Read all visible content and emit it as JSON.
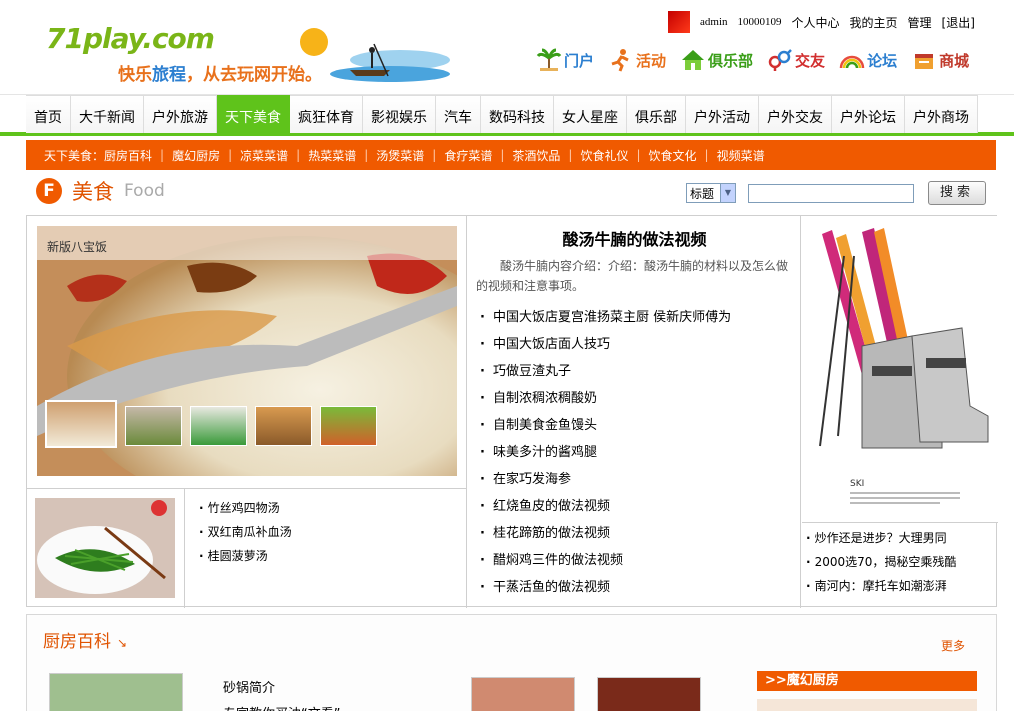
{
  "header": {
    "logo": "71play.com",
    "slogan_a": "快乐",
    "slogan_b": "旅程",
    "slogan_c": "，从去玩网开始。",
    "user": {
      "name": "admin",
      "uid": "10000109",
      "links": [
        "个人中心",
        "我的主页",
        "管理",
        "[退出]"
      ]
    },
    "main_nav": [
      {
        "label": "门户",
        "icon": "palm-tree-icon",
        "color": "#2c7fd0"
      },
      {
        "label": "活动",
        "icon": "runner-icon",
        "color": "#e8711c"
      },
      {
        "label": "俱乐部",
        "icon": "house-icon",
        "color": "#3a9e18"
      },
      {
        "label": "交友",
        "icon": "gender-icon",
        "color": "#d22f2f"
      },
      {
        "label": "论坛",
        "icon": "rainbow-icon",
        "color": "#2c7fd0"
      },
      {
        "label": "商城",
        "icon": "shop-icon",
        "color": "#c0392b"
      }
    ]
  },
  "category_nav": [
    "首页",
    "大千新闻",
    "户外旅游",
    "天下美食",
    "疯狂体育",
    "影视娱乐",
    "汽车",
    "数码科技",
    "女人星座",
    "俱乐部",
    "户外活动",
    "户外交友",
    "户外论坛",
    "户外商场"
  ],
  "category_active": "天下美食",
  "sub_nav": [
    "天下美食：厨房百科",
    "魔幻厨房",
    "凉菜菜谱",
    "热菜菜谱",
    "汤煲菜谱",
    "食疗菜谱",
    "茶酒饮品",
    "饮食礼仪",
    "饮食文化",
    "视频菜谱"
  ],
  "section": {
    "badge": "F",
    "title_cn": "美食",
    "title_en": "Food"
  },
  "search": {
    "select_value": "标题",
    "button": "搜索"
  },
  "feature": {
    "caption": "新版八宝饭",
    "mini_list": [
      "竹丝鸡四物汤",
      "双红南瓜补血汤",
      "桂圆菠萝汤"
    ]
  },
  "article": {
    "title": "酸汤牛腩的做法视频",
    "intro": "酸汤牛腩内容介绍：介绍：酸汤牛腩的材料以及怎么做的视频和注意事项。",
    "list": [
      "中国大饭店夏宫淮扬菜主厨 侯新庆师傅为",
      "中国大饭店面人技巧",
      "巧做豆渣丸子",
      "自制浓稠浓稠酸奶",
      "自制美食金鱼馒头",
      "味美多汁的酱鸡腿",
      "在家巧发海参",
      "红烧鱼皮的做法视频",
      "桂花蹄筋的做法视频",
      "醋焖鸡三件的做法视频",
      "干蒸活鱼的做法视频"
    ]
  },
  "ad": {
    "label": "SKI",
    "list": [
      "炒作还是进步？大理男同",
      "2000选70，揭秘空乘残酷",
      "南河内：摩托车如潮澎湃"
    ]
  },
  "lower": {
    "title": "厨房百科",
    "arrow": "↘",
    "more": "更多",
    "heading1": "砂锅简介",
    "heading2": "专家教你买油“文看”",
    "magic": ">>魔幻厨房"
  }
}
